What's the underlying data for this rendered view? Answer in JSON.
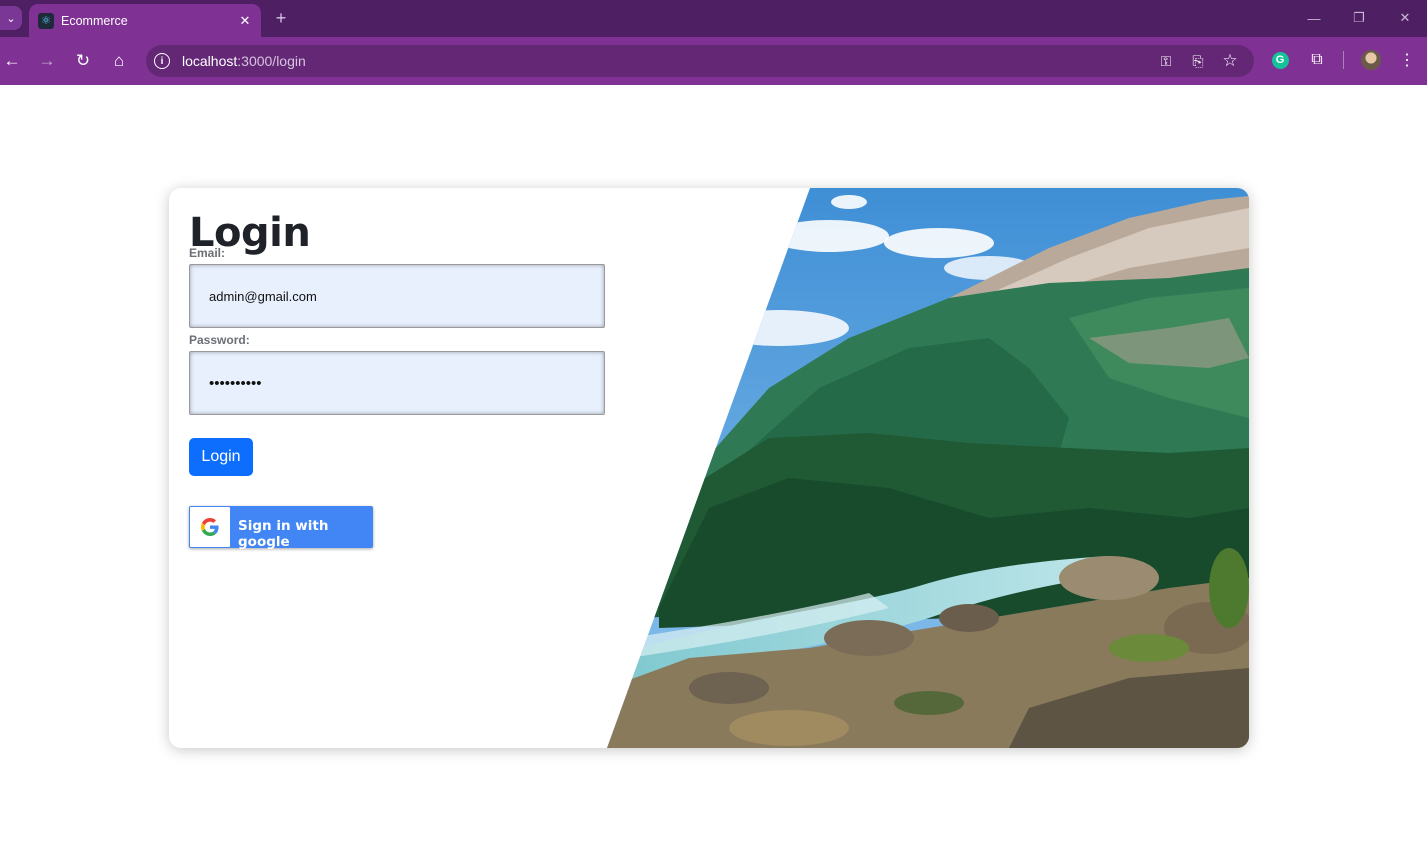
{
  "browser": {
    "tab_title": "Ecommerce",
    "url_host": "localhost",
    "url_path": ":3000/login"
  },
  "page": {
    "heading": "Login",
    "email_label": "Email:",
    "email_value": "admin@gmail.com",
    "password_label": "Password:",
    "password_value": "••••••••••",
    "login_button": "Login",
    "google_button": "Sign in with google"
  },
  "colors": {
    "tabbar": "#4e1f63",
    "toolbar": "#7f3294",
    "primary_button": "#0d6efd",
    "google_blue": "#4285f4",
    "input_bg": "#e8f0fe"
  },
  "icons": [
    "tab-search-icon",
    "react-favicon-icon",
    "close-icon",
    "plus-icon",
    "minimize-icon",
    "restore-icon",
    "window-close-icon",
    "back-icon",
    "forward-icon",
    "reload-icon",
    "home-icon",
    "site-info-icon",
    "password-key-icon",
    "install-app-icon",
    "bookmark-star-icon",
    "grammarly-icon",
    "extensions-icon",
    "profile-avatar",
    "menu-icon",
    "google-g-icon"
  ]
}
